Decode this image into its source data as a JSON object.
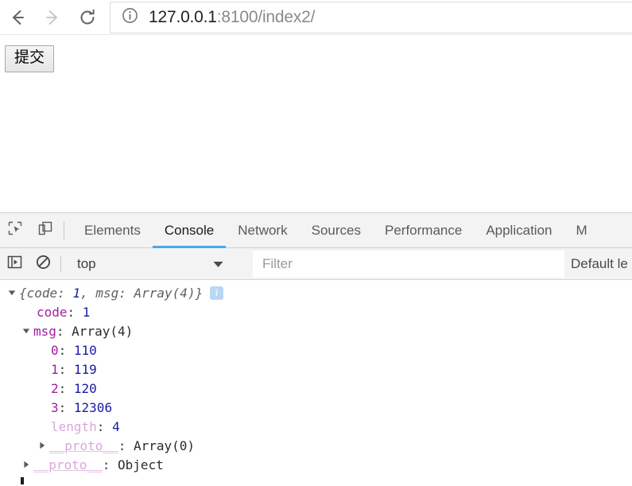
{
  "browser": {
    "back_icon": "back-arrow-icon",
    "forward_icon": "forward-arrow-icon",
    "reload_icon": "reload-icon",
    "security_icon": "info-circle-icon",
    "url_host": "127.0.0.1",
    "url_rest": ":8100/index2/"
  },
  "page": {
    "submit_label": "提交"
  },
  "devtools": {
    "inspect_icon": "inspect-element-icon",
    "device_icon": "device-toolbar-icon",
    "tabs": [
      {
        "label": "Elements",
        "active": false
      },
      {
        "label": "Console",
        "active": true
      },
      {
        "label": "Network",
        "active": false
      },
      {
        "label": "Sources",
        "active": false
      },
      {
        "label": "Performance",
        "active": false
      },
      {
        "label": "Application",
        "active": false
      },
      {
        "label": "M",
        "active": false
      }
    ],
    "filterbar": {
      "sidebar_icon": "console-sidebar-icon",
      "clear_icon": "clear-console-icon",
      "context_value": "top",
      "caret_icon": "chevron-down-icon",
      "filter_placeholder": "Filter",
      "levels_label": "Default le"
    },
    "console": {
      "rows": [
        {
          "name": "object-preview-row",
          "indent": 8,
          "triangle": "expanded",
          "text": "{code: ",
          "num": "1",
          "text2": ", msg: Array(4)}",
          "badge": "i",
          "kind": "preview"
        },
        {
          "name": "property-code-row",
          "indent": 46,
          "triangle": "none",
          "key": "code",
          "value": "1",
          "kind": "number"
        },
        {
          "name": "property-msg-row",
          "indent": 26,
          "triangle": "expanded",
          "key": "msg",
          "value": "Array(4)",
          "kind": "text"
        },
        {
          "name": "array-item-0-row",
          "indent": 64,
          "triangle": "none",
          "key": "0",
          "value": "110",
          "kind": "number"
        },
        {
          "name": "array-item-1-row",
          "indent": 64,
          "triangle": "none",
          "key": "1",
          "value": "119",
          "kind": "number"
        },
        {
          "name": "array-item-2-row",
          "indent": 64,
          "triangle": "none",
          "key": "2",
          "value": "120",
          "kind": "number"
        },
        {
          "name": "array-item-3-row",
          "indent": 64,
          "triangle": "none",
          "key": "3",
          "value": "12306",
          "kind": "number"
        },
        {
          "name": "array-length-row",
          "indent": 64,
          "triangle": "none",
          "key": "length",
          "value": "4",
          "kind": "number-dim"
        },
        {
          "name": "array-proto-row",
          "indent": 46,
          "triangle": "collapsed",
          "key": "__proto__",
          "value": "Array(0)",
          "kind": "proto"
        },
        {
          "name": "object-proto-row",
          "indent": 26,
          "triangle": "collapsed",
          "key": "__proto__",
          "value": "Object",
          "kind": "proto"
        }
      ]
    }
  },
  "colors": {
    "accent_tab_underline": "#4da6e8",
    "property_name": "#a020a0",
    "number_value": "#1a1aa6",
    "proto_name": "#d9a7d9",
    "info_badge": "#b9d7f5"
  }
}
